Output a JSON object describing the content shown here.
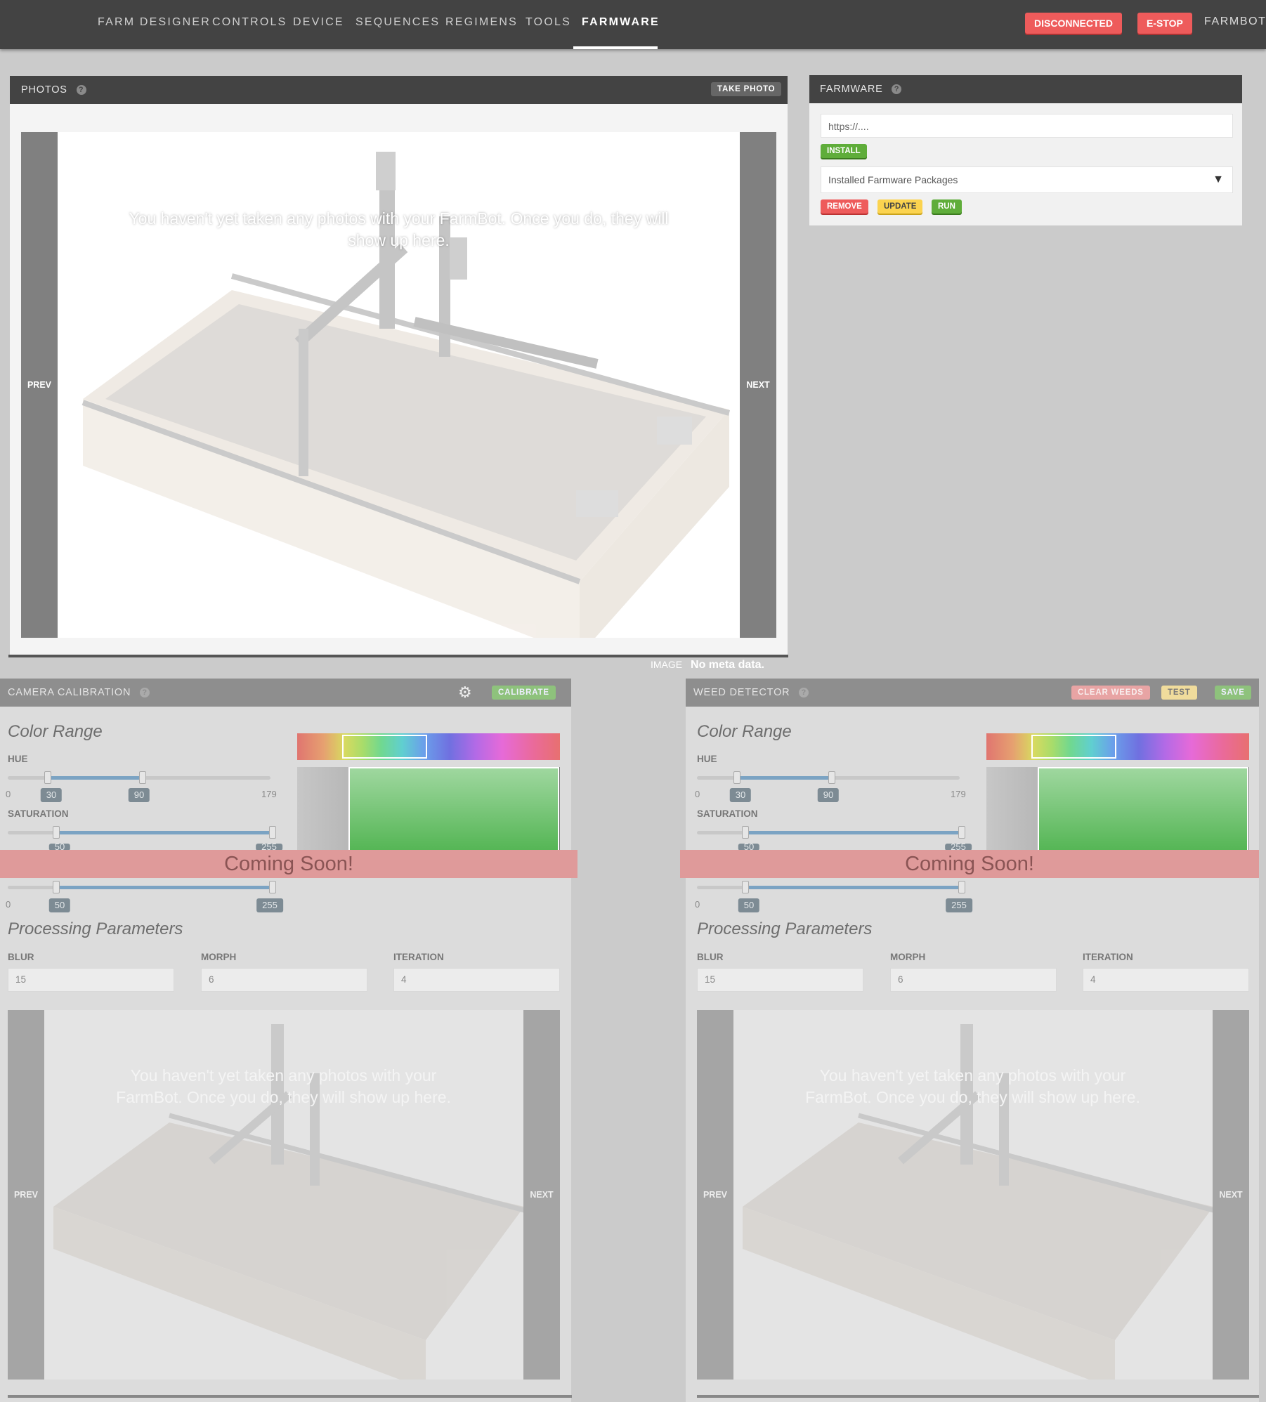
{
  "nav": {
    "links": [
      "Farm Designer",
      "Controls",
      "Device",
      "Sequences",
      "Regimens",
      "Tools",
      "Farmware"
    ],
    "active": "Farmware",
    "status_button": "DISCONNECTED",
    "estop_button": "E-STOP",
    "account": "FARMBOT",
    "account_caret": "▾"
  },
  "photos": {
    "title": "PHOTOS",
    "take_photo": "TAKE PHOTO",
    "prev": "PREV",
    "next": "NEXT",
    "empty_message": "You haven't yet taken any photos with your FarmBot. Once you do, they will show up here.",
    "meta_label": "IMAGE",
    "meta_value": "No meta data."
  },
  "farmware": {
    "title": "FARMWARE",
    "url_placeholder": "https://....",
    "install": "INSTALL",
    "select_label": "Installed Farmware Packages",
    "remove": "REMOVE",
    "update": "UPDATE",
    "run": "RUN"
  },
  "camera_calibration": {
    "title": "CAMERA CALIBRATION",
    "calibrate": "CALIBRATE",
    "color_range": "Color Range",
    "hue_label": "HUE",
    "hue_min_bound": "0",
    "hue_max_bound": "179",
    "hue_low": "30",
    "hue_high": "90",
    "saturation_label": "SATURATION",
    "sat_low": "50",
    "sat_high": "255",
    "value_min_bound": "0",
    "value_low": "50",
    "value_high": "255",
    "coming_soon": "Coming Soon!",
    "processing_parameters": "Processing Parameters",
    "blur_label": "BLUR",
    "blur_value": "15",
    "morph_label": "MORPH",
    "morph_value": "6",
    "iteration_label": "ITERATION",
    "iteration_value": "4",
    "prev": "PREV",
    "next": "NEXT",
    "empty_message": "You haven't yet taken any photos with your FarmBot. Once you do, they will show up here."
  },
  "weed_detector": {
    "title": "WEED DETECTOR",
    "clear_weeds": "CLEAR WEEDS",
    "test": "TEST",
    "save": "SAVE",
    "color_range": "Color Range",
    "hue_label": "HUE",
    "hue_min_bound": "0",
    "hue_max_bound": "179",
    "hue_low": "30",
    "hue_high": "90",
    "saturation_label": "SATURATION",
    "sat_low": "50",
    "sat_high": "255",
    "value_min_bound": "0",
    "value_low": "50",
    "value_high": "255",
    "coming_soon": "Coming Soon!",
    "processing_parameters": "Processing Parameters",
    "blur_label": "BLUR",
    "blur_value": "15",
    "morph_label": "MORPH",
    "morph_value": "6",
    "iteration_label": "ITERATION",
    "iteration_value": "4",
    "prev": "PREV",
    "next": "NEXT",
    "empty_message": "You haven't yet taken any photos with your FarmBot. Once you do, they will show up here."
  },
  "colors": {
    "nav_bg": "#434343",
    "danger": "#ee5b5b",
    "success": "#5fad3a",
    "warning": "#fbd34f"
  }
}
